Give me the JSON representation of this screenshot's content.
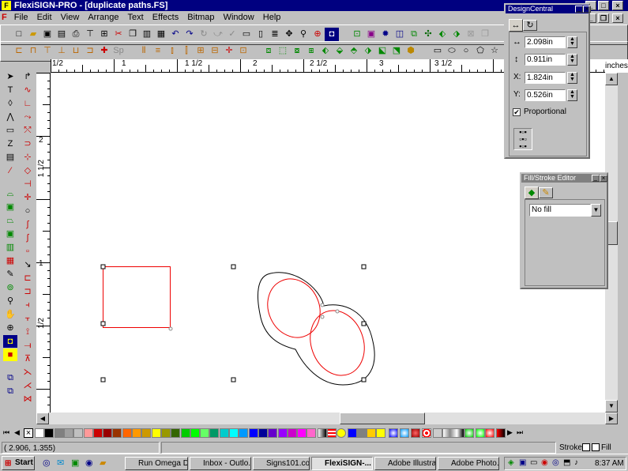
{
  "app": {
    "title": "FlexiSIGN-PRO - [duplicate paths.FS]"
  },
  "menu": [
    "File",
    "Edit",
    "View",
    "Arrange",
    "Text",
    "Effects",
    "Bitmap",
    "Window",
    "Help"
  ],
  "ruler": {
    "h_labels": [
      "1/2",
      "1",
      "1 1/2",
      "2",
      "2 1/2",
      "3",
      "3 1/2"
    ],
    "v_labels": [
      "1/2",
      "1",
      "1 1/2",
      "2"
    ],
    "units": "inches"
  },
  "design_central": {
    "title": "DesignCentral",
    "width": "2.098in",
    "height": "0.911in",
    "x": "1.824in",
    "y": "0.526in",
    "proportional_label": "Proportional",
    "proportional_checked": true
  },
  "fill_stroke": {
    "title": "Fill/Stroke Editor",
    "fill_value": "No fill"
  },
  "status": {
    "coords": "( 2.906,    1.355)",
    "stroke_label": "Stroke",
    "fill_label": "Fill"
  },
  "taskbar": {
    "start": "Start",
    "tasks": [
      "Run Omega Dem...",
      "Inbox - Outlo...",
      "Signs101.co...",
      "FlexiSIGN-...",
      "Adobe Illustra...",
      "Adobe Photo..."
    ],
    "clock": "8:37 AM"
  },
  "palette_colors": [
    "#ffffff",
    "#000000",
    "#808080",
    "#a0a0a0",
    "#c0c0c0",
    "#ff9999",
    "#cc0000",
    "#990000",
    "#993300",
    "#ff6600",
    "#ff9900",
    "#cc9900",
    "#ffff00",
    "#999900",
    "#336600",
    "#00cc00",
    "#00ff00",
    "#66ff66",
    "#009966",
    "#00cccc",
    "#00ffff",
    "#0099ff",
    "#0000ff",
    "#000099",
    "#6600cc",
    "#9900ff",
    "#cc00cc",
    "#ff00ff",
    "#ff66cc"
  ]
}
